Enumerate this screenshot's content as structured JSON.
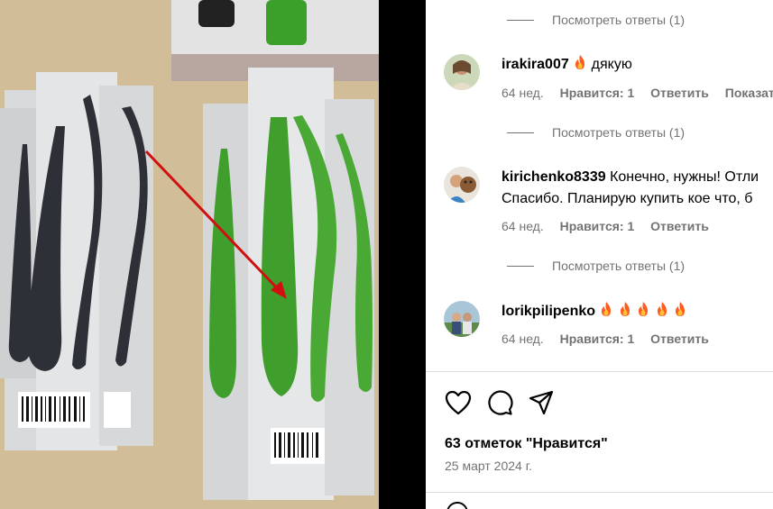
{
  "comments": [
    {
      "view_replies": "Посмотреть ответы (1)"
    },
    {
      "username": "irakira007",
      "text": "дякую",
      "fire_count": 1,
      "age": "64 нед.",
      "likes": "Нравится: 1",
      "reply": "Ответить",
      "translate": "Показать"
    },
    {
      "view_replies": "Посмотреть ответы (1)"
    },
    {
      "username": "kirichenko8339",
      "text_line1": "Конечно, нужны! Отли",
      "text_line2": "Спасибо. Планирую купить кое что, б",
      "age": "64 нед.",
      "likes": "Нравится: 1",
      "reply": "Ответить"
    },
    {
      "view_replies": "Посмотреть ответы (1)"
    },
    {
      "username": "lorikpilipenko",
      "fire_count": 5,
      "age": "64 нед.",
      "likes": "Нравится: 1",
      "reply": "Ответить"
    }
  ],
  "post": {
    "likes_text": "63 отметок \"Нравится\"",
    "date": "25 март 2024 г."
  },
  "icons": {
    "like": "heart-icon",
    "comment": "comment-icon",
    "share": "share-icon",
    "emoji": "emoji-icon",
    "fire": "fire-emoji"
  },
  "colors": {
    "muted": "#737373",
    "divider": "#dbdbdb",
    "arrow": "#d01010",
    "peeler_dark": "#2e3038",
    "peeler_green": "#3f9e2c"
  }
}
